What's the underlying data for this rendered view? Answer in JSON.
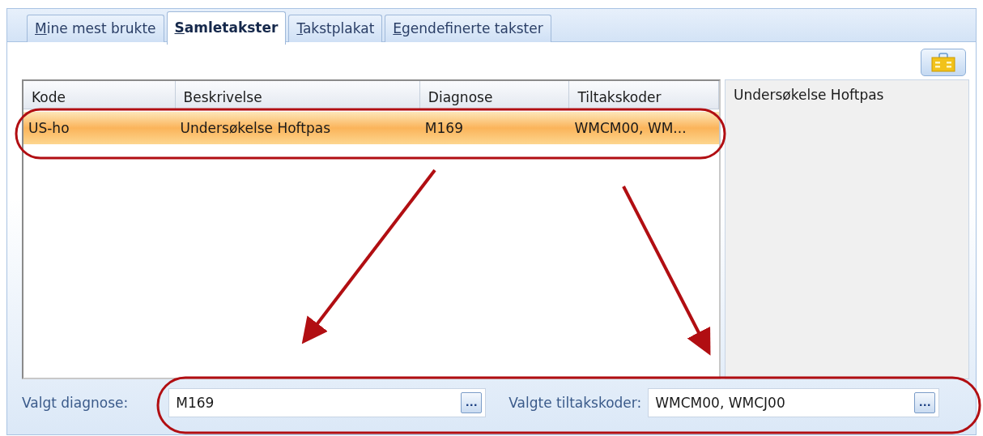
{
  "tabs": [
    {
      "label": "Mine mest brukte",
      "selected": false
    },
    {
      "label": "Samletakster",
      "selected": true
    },
    {
      "label": "Takstplakat",
      "selected": false
    },
    {
      "label": "Egendefinerte takster",
      "selected": false
    }
  ],
  "table": {
    "columns": [
      "Kode",
      "Beskrivelse",
      "Diagnose",
      "Tiltakskoder"
    ],
    "rows": [
      {
        "cells": [
          "US-ho",
          "Undersøkelse Hoftpas",
          "M169",
          "WMCM00, WM..."
        ],
        "selected": true
      }
    ]
  },
  "description_panel": {
    "text": "Undersøkelse Hoftpas"
  },
  "fields": [
    {
      "label": "Valgt diagnose:",
      "value": "M169",
      "button": "..."
    },
    {
      "label": "Valgte tiltakskoder:",
      "value": "WMCM00, WMCJ00",
      "button": "..."
    }
  ]
}
